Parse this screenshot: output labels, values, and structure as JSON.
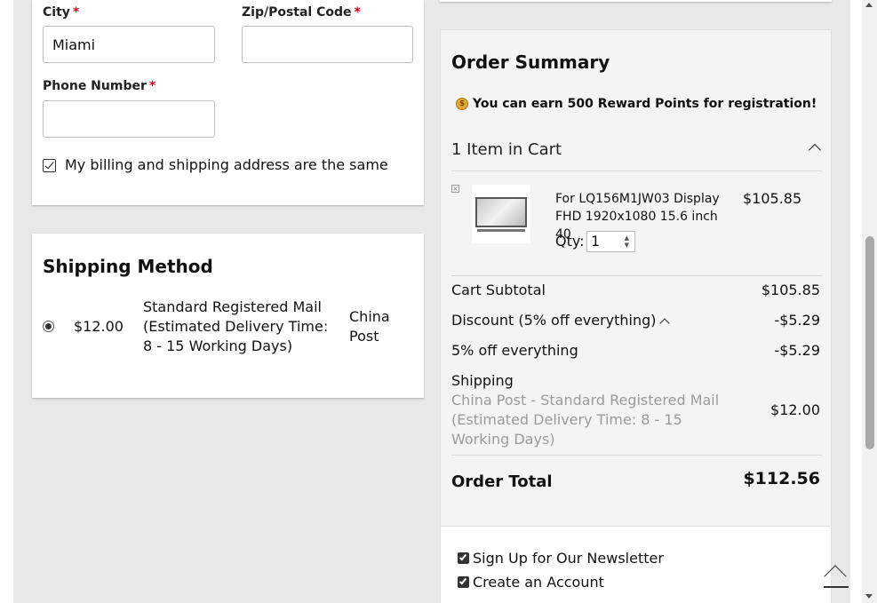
{
  "address_form": {
    "city_label": "City",
    "city_required": "*",
    "city_value": "Miami",
    "zip_label": "Zip/Postal Code",
    "zip_required": "*",
    "zip_value": "",
    "phone_label": "Phone Number",
    "phone_required": "*",
    "phone_value": "",
    "same_address_label": "My billing and shipping address are the same",
    "same_address_checked": true
  },
  "shipping_method": {
    "title": "Shipping Method",
    "options": [
      {
        "price": "$12.00",
        "method_lines": [
          "Standard Registered Mail",
          "(Estimated Delivery Time:",
          "8 - 15 Working Days)"
        ],
        "carrier_lines": [
          "China",
          "Post"
        ],
        "selected": true
      }
    ]
  },
  "order_summary": {
    "title": "Order Summary",
    "reward_icon": "coin-icon",
    "reward_prefix": "You can earn ",
    "reward_points": "500 Reward Points",
    "reward_suffix": " for registration!",
    "items_heading": "1 Item in Cart",
    "items": [
      {
        "name": "For LQ156M1JW03 Display FHD 1920x1080 15.6 inch 40",
        "price": "$105.85",
        "qty_label": "Qty:",
        "qty": "1"
      }
    ],
    "subtotal_label": "Cart Subtotal",
    "subtotal_value": "$105.85",
    "discount_label": "Discount (5% off everything)",
    "discount_value": "-$5.29",
    "discount_detail_label": "5% off everything",
    "discount_detail_value": "-$5.29",
    "shipping_label": "Shipping",
    "shipping_detail": "China Post - Standard Registered Mail (Estimated Delivery Time: 8 - 15 Working Days)",
    "shipping_value": "$12.00",
    "total_label": "Order Total",
    "total_value": "$112.56"
  },
  "options": {
    "newsletter_label": "Sign Up for Our Newsletter",
    "newsletter_checked": true,
    "create_account_label": "Create an Account",
    "create_account_checked": true
  },
  "colors": {
    "required": "#d0021b",
    "page_background": "#e8e8e8",
    "summary_background": "#f4f4f4",
    "muted_text": "#9a9a9a"
  }
}
